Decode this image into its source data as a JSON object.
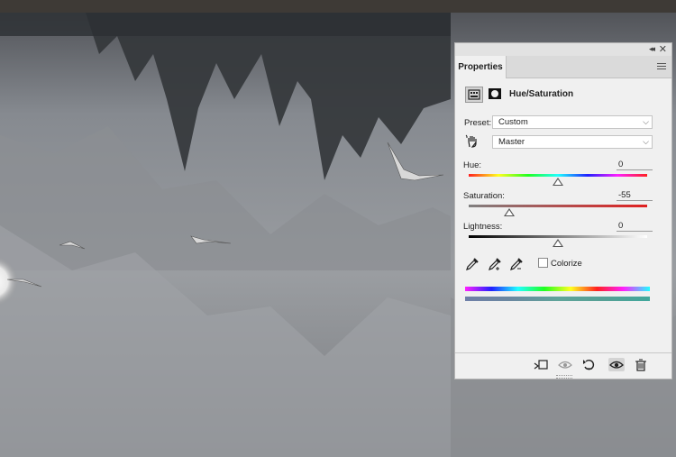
{
  "panel": {
    "tab_label": "Properties",
    "title": "Hue/Saturation",
    "preset_label": "Preset:",
    "preset_value": "Custom",
    "channel_value": "Master",
    "hue": {
      "label": "Hue:",
      "value": "0",
      "level": 0.5
    },
    "saturation": {
      "label": "Saturation:",
      "value": "-55",
      "level": 0.225
    },
    "lightness": {
      "label": "Lightness:",
      "value": "0",
      "level": 0.5
    },
    "colorize_label": "Colorize",
    "colorize_checked": false
  },
  "colors": {
    "accent": "#f0f0f0",
    "panel_border": "#b4b4b4"
  },
  "icons": [
    "collapse-icon",
    "close-icon",
    "panel-menu-icon",
    "adjustment-layer-icon",
    "layer-mask-icon",
    "targeted-adjust-hand-icon",
    "eyedropper-icon",
    "eyedropper-add-icon",
    "eyedropper-subtract-icon",
    "clip-to-layer-icon",
    "view-previous-icon",
    "reset-icon",
    "visibility-eye-icon",
    "trash-icon"
  ]
}
